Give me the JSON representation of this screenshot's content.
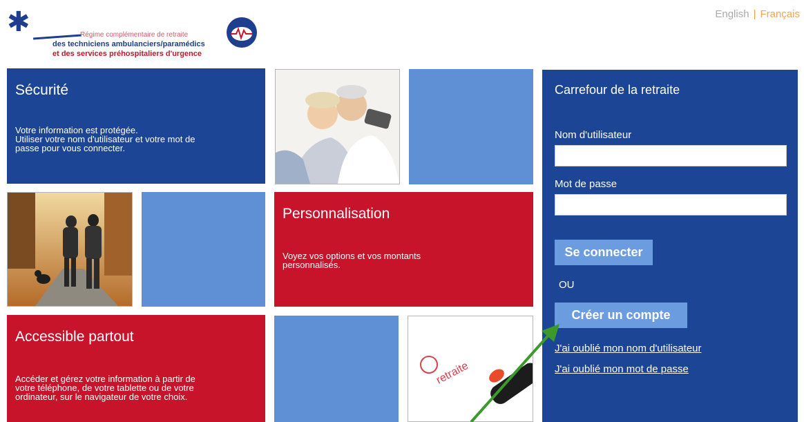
{
  "header": {
    "logo_line1": "Régime complémentaire de retraite",
    "logo_line2": "des techniciens ambulanciers/paramédics",
    "logo_line3": "et des services préhospitaliers d'urgence",
    "lang_english": "English",
    "lang_separator": "|",
    "lang_french": "Français"
  },
  "tiles": {
    "security": {
      "title": "Sécurité",
      "text": "Votre information est protégée.\nUtiliser votre nom d'utilisateur et votre mot de\npasse pour vous connecter."
    },
    "personalization": {
      "title": "Personnalisation",
      "text": "Voyez vos options et vos montants\npersonnalisés."
    },
    "accessible": {
      "title": "Accessible partout",
      "text": "Accéder et gérez votre information à partir de\nvotre téléphone, de votre tablette ou de votre\nordinateur, sur le navigateur de votre choix."
    },
    "stamp_text": "retraite"
  },
  "login": {
    "title": "Carrefour de la retraite",
    "username_label": "Nom d'utilisateur",
    "username_value": "",
    "password_label": "Mot de passe",
    "password_value": "",
    "login_button": "Se connecter",
    "or_text": "OU",
    "create_account_button": "Créer un compte",
    "forgot_username": "J'ai oublié mon nom d'utilisateur",
    "forgot_password": "J'ai oublié mon mot de passe"
  },
  "colors": {
    "navy": "#1d4596",
    "light_blue": "#5f8fd4",
    "red": "#c7142b",
    "button": "#6b9ce0",
    "arrow": "#3c9a2c"
  },
  "icons": [
    "star-of-life-icon",
    "piggy-bank-seal-icon"
  ]
}
